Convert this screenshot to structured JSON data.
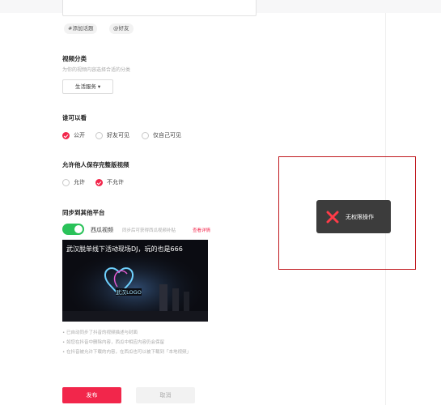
{
  "form": {
    "tags": [
      "#添加话题",
      "@好友"
    ],
    "category": {
      "title": "视频分类",
      "subtitle": "为你的视频内容选择合适的分类",
      "selected": "生活服务 ▾"
    },
    "visibility": {
      "title": "谁可以看",
      "options": [
        "公开",
        "好友可见",
        "仅自己可见"
      ],
      "selected_index": 0
    },
    "download": {
      "title": "允许他人保存完整版视频",
      "options": [
        "允许",
        "不允许"
      ],
      "selected_index": 1
    },
    "sync": {
      "title": "同步到其他平台",
      "platform_label": "西瓜视频",
      "enabled": true,
      "hint": "同步后可获得西瓜视频补贴",
      "hint_link": "查看详情",
      "video_title": "武汉脱单线下活动现场DJ，玩的也是666",
      "notes": [
        "• 已自动同步了抖音的视频描述与封面",
        "• 如您在抖音中删除内容，西瓜中相应内容仍会保留",
        "• 在抖音被允许下载的内容，在西瓜也可以被下载到「本地视频」"
      ]
    },
    "buttons": {
      "publish": "发布",
      "cancel": "取消"
    }
  },
  "toast": {
    "text": "无权限操作",
    "icon": "close-x-icon"
  },
  "colors": {
    "accent": "#f2264b",
    "toggle_on": "#2ac259",
    "toast_bg": "#3c3c3c",
    "highlight_border": "#c0191f"
  }
}
